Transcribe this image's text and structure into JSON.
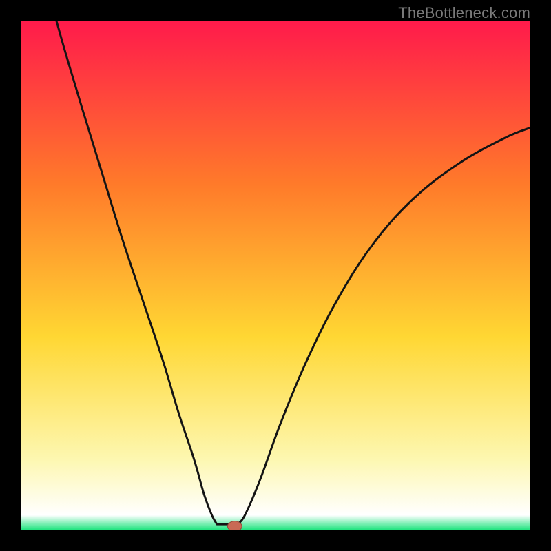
{
  "watermark": "TheBottleneck.com",
  "colors": {
    "bg_black": "#000000",
    "grad_top": "#ff1a4b",
    "grad_mid1": "#ff7a2a",
    "grad_mid2": "#ffd733",
    "grad_pale_yellow": "#fdf7b0",
    "grad_green": "#17e37a",
    "curve_stroke": "#141414",
    "marker_fill": "#c96a55",
    "marker_stroke": "#8e4a3a"
  },
  "chart_data": {
    "type": "line",
    "title": "",
    "xlabel": "",
    "ylabel": "",
    "xlim": [
      0,
      100
    ],
    "ylim": [
      0,
      100
    ],
    "left_curve": {
      "name": "left-branch",
      "points": [
        {
          "x": 7,
          "y": 100
        },
        {
          "x": 9,
          "y": 93
        },
        {
          "x": 12,
          "y": 83
        },
        {
          "x": 16,
          "y": 70
        },
        {
          "x": 20,
          "y": 57
        },
        {
          "x": 24,
          "y": 45
        },
        {
          "x": 28,
          "y": 33
        },
        {
          "x": 31,
          "y": 23
        },
        {
          "x": 34,
          "y": 14
        },
        {
          "x": 36,
          "y": 7
        },
        {
          "x": 37.5,
          "y": 3
        },
        {
          "x": 38.5,
          "y": 1.2
        }
      ]
    },
    "flat_segment": {
      "name": "valley-flat",
      "points": [
        {
          "x": 38.5,
          "y": 1.2
        },
        {
          "x": 42.5,
          "y": 1.2
        }
      ]
    },
    "right_curve": {
      "name": "right-branch",
      "points": [
        {
          "x": 42.5,
          "y": 1.2
        },
        {
          "x": 44,
          "y": 3
        },
        {
          "x": 47,
          "y": 10
        },
        {
          "x": 51,
          "y": 21
        },
        {
          "x": 56,
          "y": 33
        },
        {
          "x": 62,
          "y": 45
        },
        {
          "x": 69,
          "y": 56
        },
        {
          "x": 77,
          "y": 65
        },
        {
          "x": 86,
          "y": 72
        },
        {
          "x": 95,
          "y": 77
        },
        {
          "x": 100,
          "y": 79
        }
      ]
    },
    "marker": {
      "x": 42,
      "y": 0.8,
      "rx": 1.4,
      "ry": 1.0
    }
  }
}
